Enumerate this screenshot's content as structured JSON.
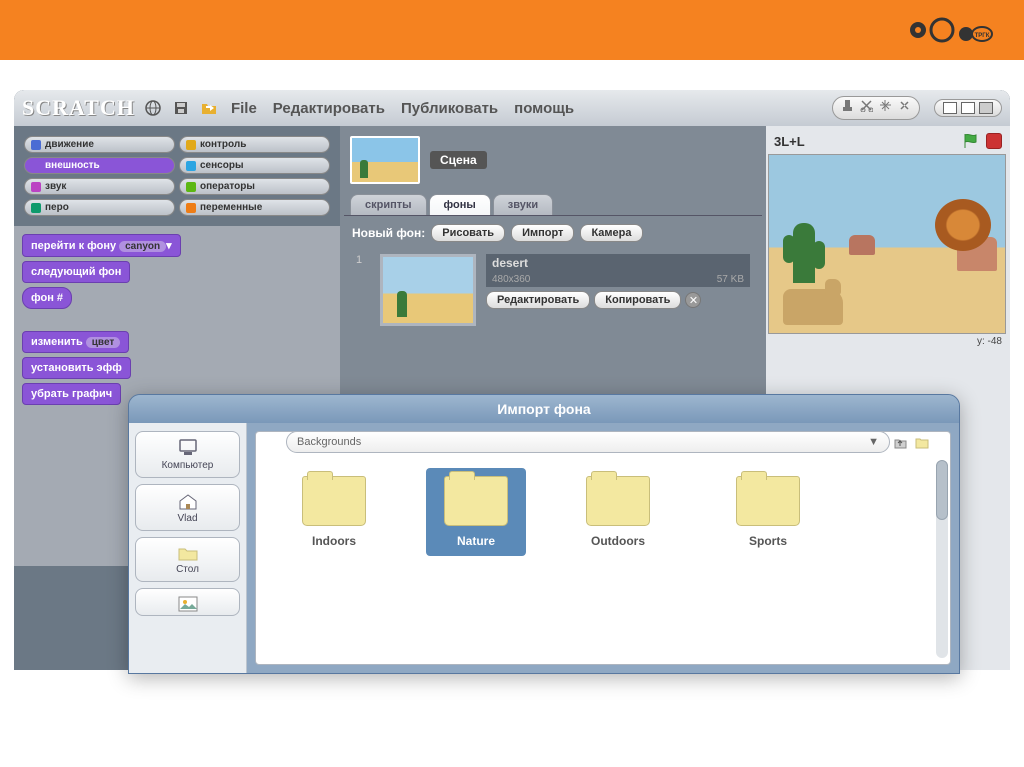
{
  "brand": "pobo",
  "app_name": "SCRATCH",
  "menu": {
    "file": "File",
    "edit": "Редактировать",
    "publish": "Публиковать",
    "help": "помощь"
  },
  "categories": {
    "motion": "движение",
    "control": "контроль",
    "looks": "внешность",
    "sensing": "сенсоры",
    "sound": "звук",
    "operators": "операторы",
    "pen": "перо",
    "variables": "переменные"
  },
  "cat_colors": {
    "motion": "#4a6cd4",
    "control": "#e1a91a",
    "looks": "#8a55d7",
    "sensing": "#2ca5e2",
    "sound": "#bb42c3",
    "operators": "#5cb712",
    "pen": "#0e9a6c",
    "variables": "#ee7d16"
  },
  "blocks": {
    "switch_bg_label": "перейти к фону",
    "switch_bg_value": "canyon",
    "next_bg": "следующий фон",
    "bg_num": "фон #",
    "change_effect": "изменить",
    "change_effect_slot": "цвет",
    "set_effect": "установить эфф",
    "clear_graphics": "убрать графич"
  },
  "sprite": {
    "name": "Сцена"
  },
  "tabs": {
    "scripts": "скрипты",
    "backgrounds": "фоны",
    "sounds": "звуки"
  },
  "new_bg": {
    "label": "Новый фон:",
    "paint": "Рисовать",
    "import": "Импорт",
    "camera": "Камера"
  },
  "bg_item": {
    "index": "1",
    "name": "desert",
    "dims": "480x360",
    "size": "57 KB",
    "edit": "Редактировать",
    "copy": "Копировать"
  },
  "stage": {
    "title": "3L+L",
    "coords": "y: -48"
  },
  "dialog": {
    "title": "Импорт фона",
    "path": "Backgrounds",
    "sidebar": {
      "computer": "Компьютер",
      "user": "Vlad",
      "desktop": "Стол"
    },
    "folders": {
      "indoors": "Indoors",
      "nature": "Nature",
      "outdoors": "Outdoors",
      "sports": "Sports"
    }
  }
}
